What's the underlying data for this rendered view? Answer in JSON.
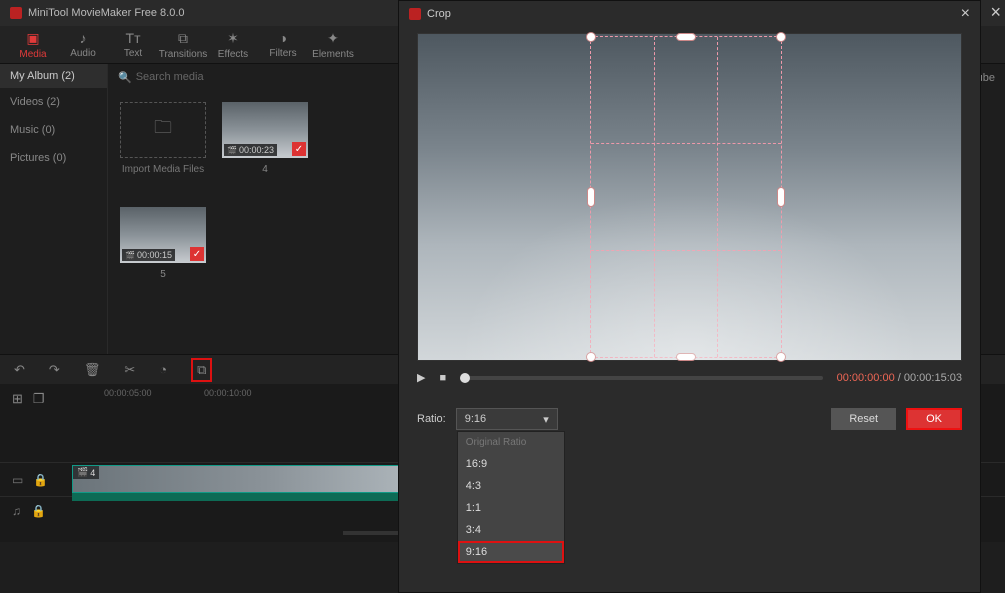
{
  "app": {
    "title": "MiniTool MovieMaker Free 8.0.0"
  },
  "topnav": [
    {
      "label": "Media",
      "icon": "folder"
    },
    {
      "label": "Audio",
      "icon": "note"
    },
    {
      "label": "Text",
      "icon": "T"
    },
    {
      "label": "Transitions",
      "icon": "trans"
    },
    {
      "label": "Effects",
      "icon": "fx"
    },
    {
      "label": "Filters",
      "icon": "filter"
    },
    {
      "label": "Elements",
      "icon": "spark"
    }
  ],
  "sidebar": {
    "album": "My Album (2)",
    "items": [
      {
        "label": "Videos (2)"
      },
      {
        "label": "Music (0)"
      },
      {
        "label": "Pictures (0)"
      }
    ]
  },
  "mediaTop": {
    "search": "Search media",
    "download": "Download YouTube"
  },
  "mediaGrid": {
    "importLabel": "Import Media Files",
    "items": [
      {
        "duration": "00:00:23",
        "caption": "4"
      },
      {
        "duration": "00:00:15",
        "caption": "5"
      }
    ]
  },
  "timeline": {
    "ruler": {
      "t1": "00:00:05:00",
      "t2": "00:00:10:00"
    },
    "clipLabel": "4"
  },
  "crop": {
    "title": "Crop",
    "time": {
      "current": "00:00:00:00",
      "total": "00:00:15:03"
    },
    "ratioLabel": "Ratio:",
    "ratioValue": "9:16",
    "options": [
      {
        "label": "Original Ratio",
        "faded": true
      },
      {
        "label": "16:9"
      },
      {
        "label": "4:3"
      },
      {
        "label": "1:1"
      },
      {
        "label": "3:4"
      },
      {
        "label": "9:16",
        "selected": true
      }
    ],
    "reset": "Reset",
    "ok": "OK"
  }
}
